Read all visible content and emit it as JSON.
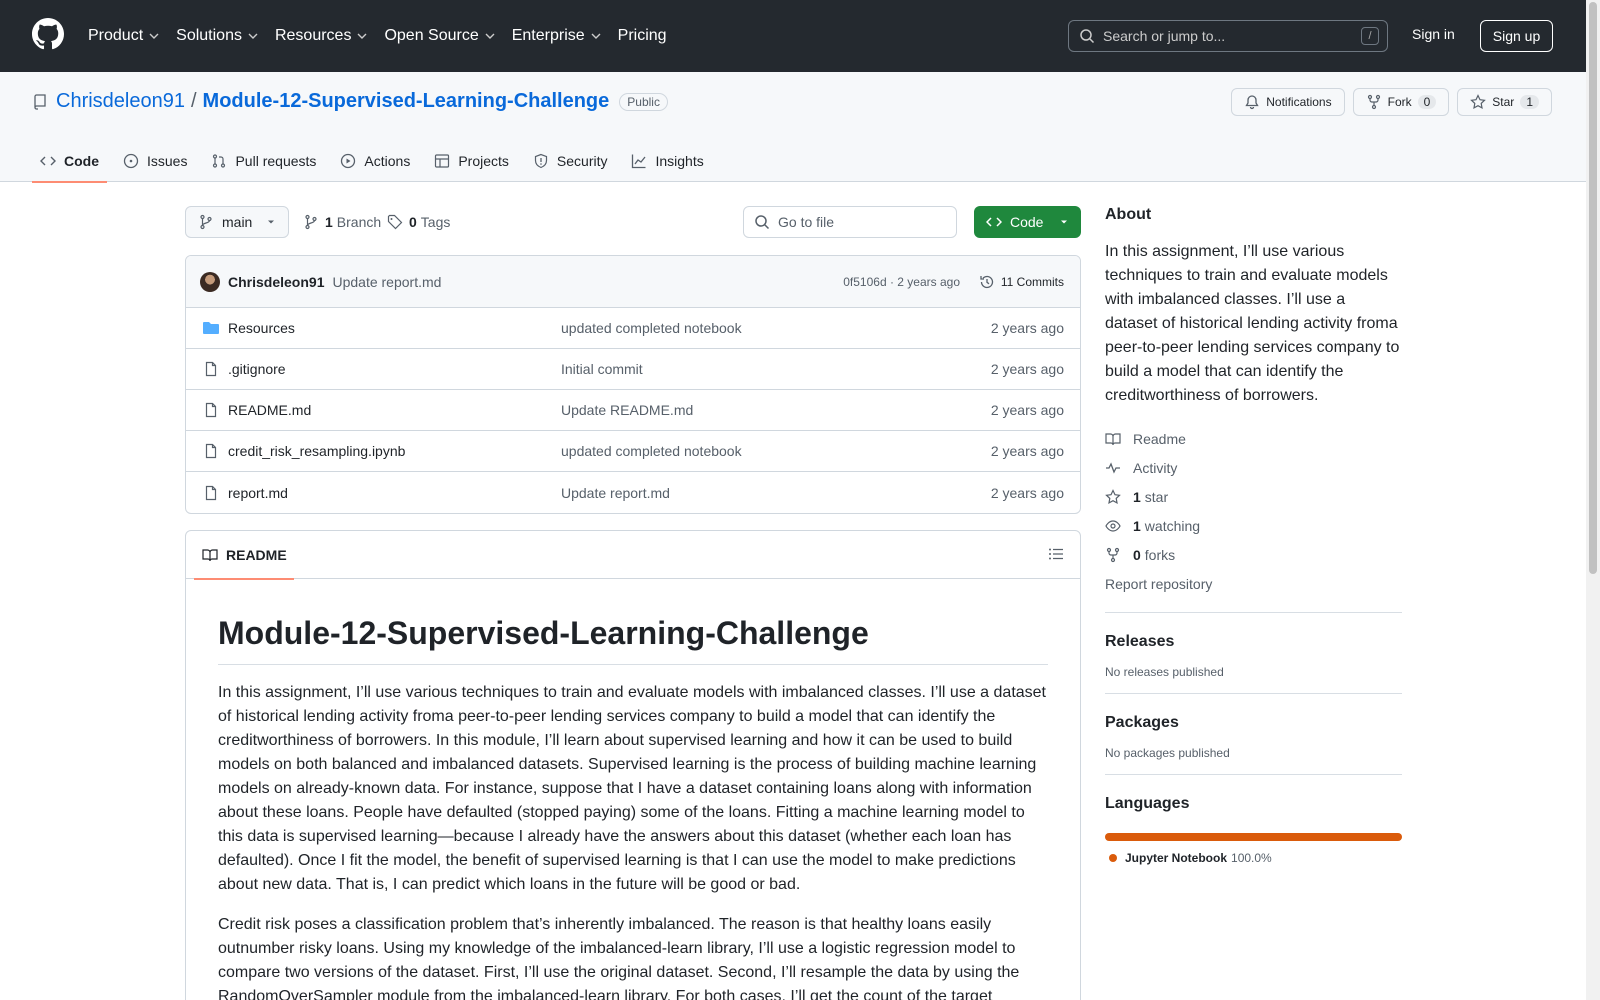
{
  "header": {
    "nav": [
      "Product",
      "Solutions",
      "Resources",
      "Open Source",
      "Enterprise",
      "Pricing"
    ],
    "search_placeholder": "Search or jump to...",
    "search_shortcut": "/",
    "signin": "Sign in",
    "signup": "Sign up"
  },
  "repo": {
    "owner": "Chrisdeleon91",
    "separator": "/",
    "name": "Module-12-Supervised-Learning-Challenge",
    "visibility": "Public",
    "notifications": "Notifications",
    "fork_label": "Fork",
    "fork_count": "0",
    "star_label": "Star",
    "star_count": "1"
  },
  "tabs": [
    "Code",
    "Issues",
    "Pull requests",
    "Actions",
    "Projects",
    "Security",
    "Insights"
  ],
  "toolbar": {
    "branch": "main",
    "branch_count": "1",
    "branch_label": "Branch",
    "tag_count": "0",
    "tag_label": "Tags",
    "goto_placeholder": "Go to file",
    "code_button": "Code"
  },
  "commit": {
    "author": "Chrisdeleon91",
    "message": "Update report.md",
    "meta": "0f5106d · 2 years ago",
    "commits": "11 Commits"
  },
  "files": [
    {
      "name": "Resources",
      "type": "folder",
      "message": "updated completed notebook",
      "date": "2 years ago"
    },
    {
      "name": ".gitignore",
      "type": "file",
      "message": "Initial commit",
      "date": "2 years ago"
    },
    {
      "name": "README.md",
      "type": "file",
      "message": "Update README.md",
      "date": "2 years ago"
    },
    {
      "name": "credit_risk_resampling.ipynb",
      "type": "file",
      "message": "updated completed notebook",
      "date": "2 years ago"
    },
    {
      "name": "report.md",
      "type": "file",
      "message": "Update report.md",
      "date": "2 years ago"
    }
  ],
  "readme": {
    "tab": "README",
    "title": "Module-12-Supervised-Learning-Challenge",
    "p1": "In this assignment, I’ll use various techniques to train and evaluate models with imbalanced classes. I’ll use a dataset of historical lending activity froma peer-to-peer lending services company to build a model that can identify the creditworthiness of borrowers. In this module, I’ll learn about supervised learning and how it can be used to build models on both balanced and imbalanced datasets. Supervised learning is the process of building machine learning models on already-known data. For instance, suppose that I have a dataset containing loans along with information about these loans. People have defaulted (stopped paying) some of the loans. Fitting a machine learning model to this data is supervised learning—because I already have the answers about this dataset (whether each loan has defaulted). Once I fit the model, the benefit of supervised learning is that I can use the model to make predictions about new data. That is, I can predict which loans in the future will be good or bad.",
    "p2": "Credit risk poses a classification problem that’s inherently imbalanced. The reason is that healthy loans easily outnumber risky loans. Using my knowledge of the imbalanced-learn library, I’ll use a logistic regression model to compare two versions of the dataset. First, I’ll use the original dataset. Second, I’ll resample the data by using the RandomOverSampler module from the imbalanced-learn library. For both cases, I’ll get the count of the target"
  },
  "sidebar": {
    "about_title": "About",
    "about_text": "In this assignment, I’ll use various techniques to train and evaluate models with imbalanced classes. I’ll use a dataset of historical lending activity froma peer-to-peer lending services company to build a model that can identify the creditworthiness of borrowers.",
    "readme": "Readme",
    "activity": "Activity",
    "stars_count": "1",
    "stars_label": "star",
    "watching_count": "1",
    "watching_label": "watching",
    "forks_count": "0",
    "forks_label": "forks",
    "report": "Report repository",
    "releases_title": "Releases",
    "releases_text": "No releases published",
    "packages_title": "Packages",
    "packages_text": "No packages published",
    "languages_title": "Languages",
    "language_name": "Jupyter Notebook",
    "language_pct": "100.0%",
    "language_color": "#da5b0b"
  }
}
